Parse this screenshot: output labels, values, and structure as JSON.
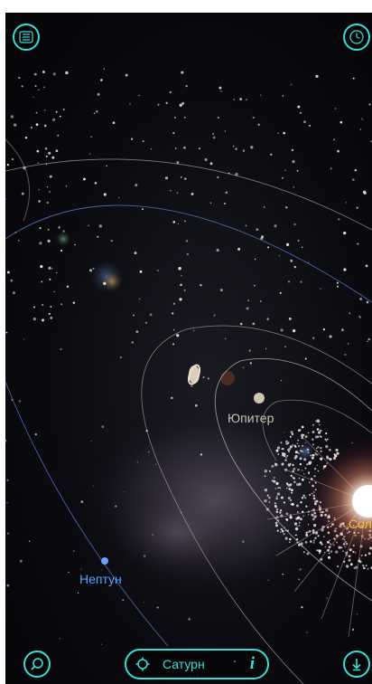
{
  "labels": {
    "jupiter": "Юпитер",
    "neptune": "Нептун",
    "sun_partial": "Сол"
  },
  "target": {
    "name": "Сатурн",
    "info_glyph": "i"
  },
  "icons": {
    "menu": "menu-icon",
    "time": "clock-icon",
    "search": "search-icon",
    "target": "crosshair-icon",
    "info": "info-icon",
    "download": "download-icon"
  },
  "colors": {
    "accent": "#34e0d6",
    "jupiter_label": "#c9c3b8",
    "neptune_label": "#5aa3ff",
    "sun_label": "#f2c230"
  }
}
